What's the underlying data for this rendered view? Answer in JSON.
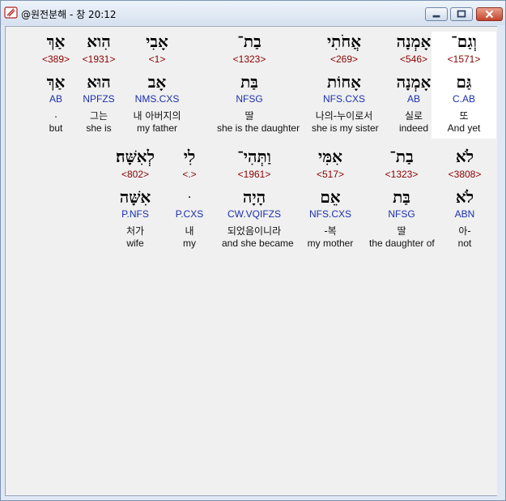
{
  "window": {
    "title": "@원전분해 - 창 20:12",
    "app_icon": "bible-icon"
  },
  "rows": [
    [
      {
        "heb": "וְגַם־",
        "strong": "<1571>",
        "lemma": "גַּם",
        "parse": "C.AB",
        "kor": "또",
        "eng": "And yet",
        "highlight": true
      },
      {
        "heb": "אָמְנָה",
        "strong": "<546>",
        "lemma": "אָמְנָה",
        "parse": "AB",
        "kor": "실로",
        "eng": "indeed",
        "highlight": false
      },
      {
        "heb": "אֲחֹתִי",
        "strong": "<269>",
        "lemma": "אָחוֹת",
        "parse": "NFS.CXS",
        "kor": "나의-누이로서",
        "eng": "she is my sister",
        "highlight": false
      },
      {
        "heb": "בַת־",
        "strong": "<1323>",
        "lemma": "בַּת",
        "parse": "NFSG",
        "kor": "딸",
        "eng": "she is the daughter",
        "highlight": false
      },
      {
        "heb": "אָבִי",
        "strong": "<1>",
        "lemma": "אָב",
        "parse": "NMS.CXS",
        "kor": "내 아버지의",
        "eng": "my father",
        "highlight": false
      },
      {
        "heb": "הִוא",
        "strong": "<1931>",
        "lemma": "הוּא",
        "parse": "NPFZS",
        "kor": "그는",
        "eng": "she is",
        "highlight": false
      },
      {
        "heb": "אַךְ",
        "strong": "<389>",
        "lemma": "אַךְ",
        "parse": "AB",
        "kor": ".",
        "eng": "but",
        "highlight": false
      }
    ],
    [
      {
        "heb": "לֹא",
        "strong": "<3808>",
        "lemma": "לֹא",
        "parse": "ABN",
        "kor": "아-",
        "eng": "not",
        "highlight": false
      },
      {
        "heb": "בַת־",
        "strong": "<1323>",
        "lemma": "בַּת",
        "parse": "NFSG",
        "kor": "딸",
        "eng": "the daughter of",
        "highlight": false
      },
      {
        "heb": "אִמִּי",
        "strong": "<517>",
        "lemma": "אֵם",
        "parse": "NFS.CXS",
        "kor": "-복",
        "eng": "my mother",
        "highlight": false
      },
      {
        "heb": "וַתְּהִי־",
        "strong": "<1961>",
        "lemma": "הָיָה",
        "parse": "CW.VQIFZS",
        "kor": "되었음이니라",
        "eng": "and she became",
        "highlight": false
      },
      {
        "heb": "לִי",
        "strong": "<.>",
        "lemma": "ּ",
        "parse": "P.CXS",
        "kor": "내",
        "eng": "my",
        "highlight": false
      },
      {
        "heb": "לְאִשָּׁה׃",
        "strong": "<802>",
        "lemma": "אִשָּׁה",
        "parse": "P.NFS",
        "kor": "처가",
        "eng": "wife",
        "highlight": false
      }
    ]
  ]
}
